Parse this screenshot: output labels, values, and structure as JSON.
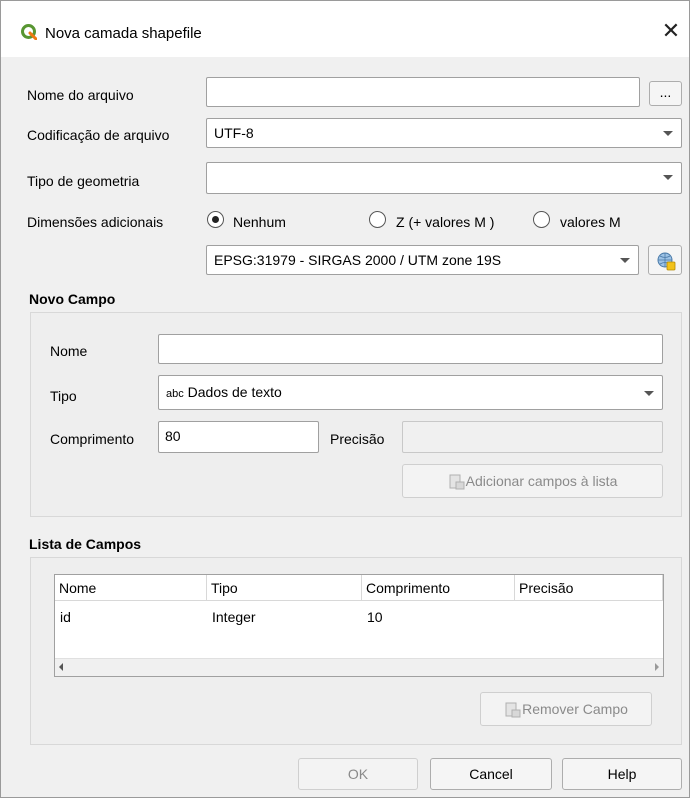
{
  "window": {
    "title": "Nova camada shapefile",
    "close_glyph": "✕"
  },
  "file": {
    "label": "Nome do arquivo",
    "value": "",
    "browse_label": "..."
  },
  "encoding": {
    "label": "Codificação de arquivo",
    "value": "UTF-8"
  },
  "geometry": {
    "label": "Tipo de geometria",
    "value": ""
  },
  "dimensions": {
    "label": "Dimensões adicionais",
    "options": [
      {
        "label": "Nenhum",
        "checked": true
      },
      {
        "label": "Z (+ valores M )",
        "checked": false
      },
      {
        "label": "valores M",
        "checked": false
      }
    ]
  },
  "crs": {
    "value": "EPSG:31979 - SIRGAS 2000 / UTM zone 19S",
    "icon": "globe-crs-icon"
  },
  "new_field": {
    "group_title": "Novo Campo",
    "name_label": "Nome",
    "name_value": "",
    "type_label": "Tipo",
    "type_prefix": "abc",
    "type_value": "Dados de texto",
    "length_label": "Comprimento",
    "length_value": "80",
    "precision_label": "Precisão",
    "precision_value": "",
    "add_button": "Adicionar campos à lista"
  },
  "field_list": {
    "group_title": "Lista de Campos",
    "columns": [
      "Nome",
      "Tipo",
      "Comprimento",
      "Precisão"
    ],
    "rows": [
      {
        "nome": "id",
        "tipo": "Integer",
        "comprimento": "10",
        "precisao": ""
      }
    ],
    "remove_button": "Remover Campo"
  },
  "footer": {
    "ok": "OK",
    "cancel": "Cancel",
    "help": "Help"
  },
  "colors": {
    "qgis_green": "#589632",
    "qgis_yellow": "#ee7913"
  }
}
